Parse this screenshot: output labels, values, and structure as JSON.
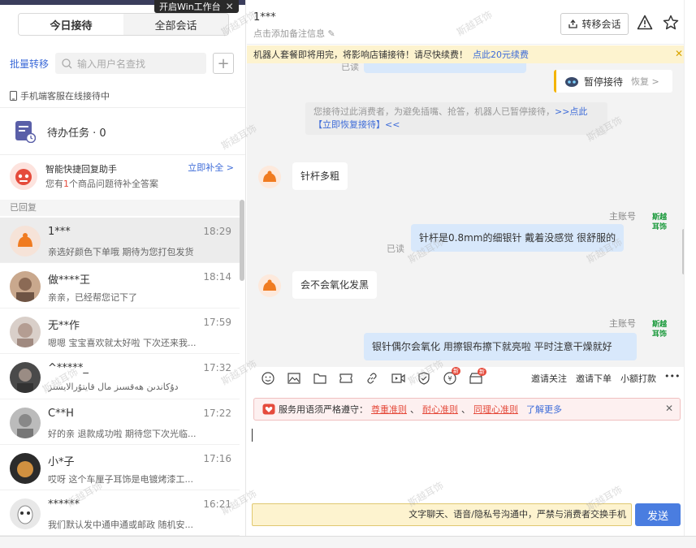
{
  "left": {
    "tabs": [
      "今日接待",
      "全部会话"
    ],
    "win_hint": "开启Win工作台",
    "bulk_transfer": "批量转移",
    "search_placeholder": "输入用户名查找",
    "mobile_status": "手机端客服在线接待中",
    "todo": "待办任务 · 0",
    "assist_title": "智能快捷回复助手",
    "assist_desc_pre": "您有",
    "assist_desc_num": "1",
    "assist_desc_post": "个商品问题待补全答案",
    "assist_link": "立即补全 >",
    "section": "已回复",
    "conversations": [
      {
        "name": "1***",
        "time": "18:29",
        "msg": "亲选好颜色下单哦 期待为您打包发货"
      },
      {
        "name": "做****王",
        "time": "18:14",
        "msg": "亲亲，已经帮您记下了"
      },
      {
        "name": "无**作",
        "time": "17:59",
        "msg": "嗯嗯 宝宝喜欢就太好啦 下次还来我..."
      },
      {
        "name": "^*****_",
        "time": "17:32",
        "msg": "دۇكاندىن ھەقسىز مال قايتۇرالايسىز"
      },
      {
        "name": "C**H",
        "time": "17:22",
        "msg": "好的亲 退款成功啦 期待您下次光临..."
      },
      {
        "name": "小*子",
        "time": "17:16",
        "msg": "哎呀 这个车厘子耳饰是电镀烤漆工..."
      },
      {
        "name": "******",
        "time": "16:21",
        "msg": "我们默认发中通申通或邮政 随机安..."
      }
    ]
  },
  "header": {
    "name": "1***",
    "note": "点击添加备注信息",
    "transfer": "转移会话"
  },
  "banner": {
    "text": "机器人套餐即将用完，将影响店铺接待！请尽快续费！",
    "link": "点此20元续费"
  },
  "chat": {
    "read": "已读",
    "pause_label": "暂停接待",
    "pause_resume": "恢复 >",
    "system_msg": "您接待过此消费者，为避免插嘴、抢答，机器人已暂停接待，",
    "system_link": ">>点此【立即恢复接待】<<",
    "msg1": "针杆多粗",
    "acct_label": "主账号",
    "reply1": "针杆是0.8mm的细银针 戴着没感觉 很舒服的",
    "msg2": "会不会氧化发黑",
    "reply2": "银针偶尔会氧化 用擦银布擦下就亮啦 平时注意干燥就好",
    "seal_text": "斯越 耳饰"
  },
  "toolbar": {
    "invite_follow": "邀请关注",
    "invite_order": "邀请下单",
    "tip": "小额打款",
    "more": "•••",
    "badge": "新"
  },
  "notice": {
    "label": "服务用语须严格遵守：",
    "rule1": "尊重准则",
    "rule2": "耐心准则",
    "rule3": "同理心准则",
    "sep": "、",
    "link": "了解更多"
  },
  "footer": {
    "hint": "文字聊天、语音/隐私号沟通中，严禁与消费者交换手机",
    "send": "发送"
  },
  "watermark": "斯越耳饰",
  "colors": {
    "accent": "#3d6bd8",
    "send": "#4a7de0",
    "warning": "#e54b3c"
  }
}
